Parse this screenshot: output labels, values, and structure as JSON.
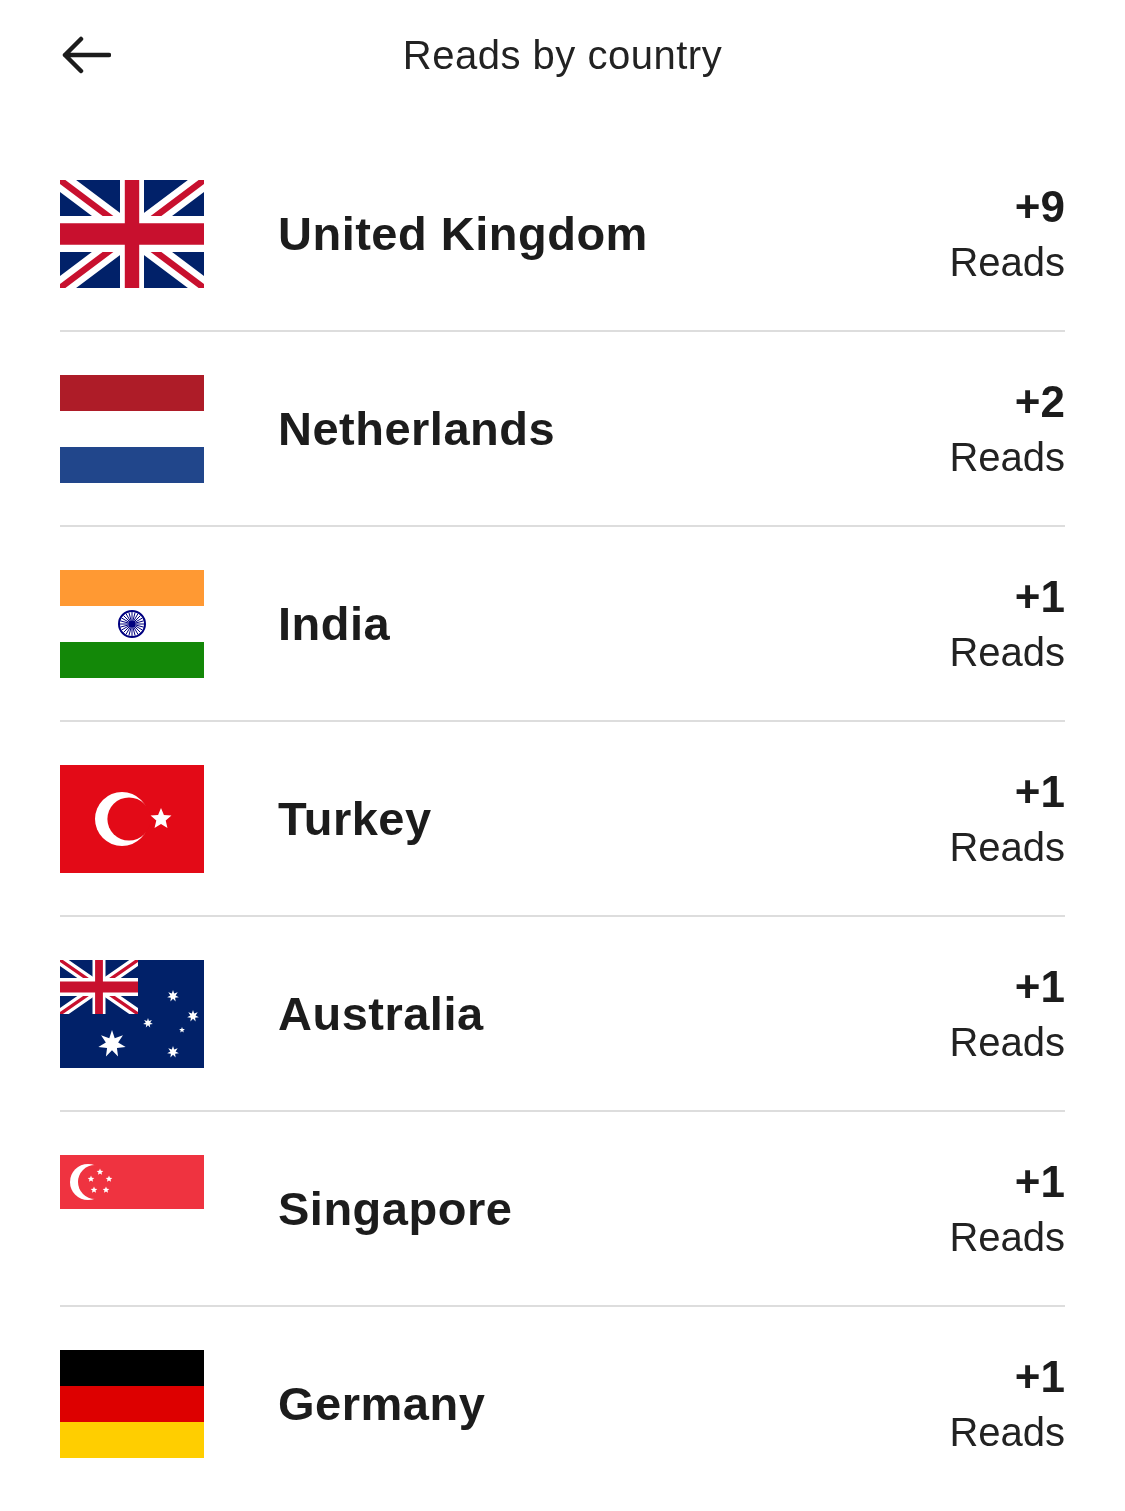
{
  "header": {
    "title": "Reads by country"
  },
  "countries": [
    {
      "kind": "gb",
      "name": "United Kingdom",
      "count": "+9",
      "unit": "Reads"
    },
    {
      "kind": "nl",
      "name": "Netherlands",
      "count": "+2",
      "unit": "Reads"
    },
    {
      "kind": "in",
      "name": "India",
      "count": "+1",
      "unit": "Reads"
    },
    {
      "kind": "tr",
      "name": "Turkey",
      "count": "+1",
      "unit": "Reads"
    },
    {
      "kind": "au",
      "name": "Australia",
      "count": "+1",
      "unit": "Reads"
    },
    {
      "kind": "sg",
      "name": "Singapore",
      "count": "+1",
      "unit": "Reads"
    },
    {
      "kind": "de",
      "name": "Germany",
      "count": "+1",
      "unit": "Reads"
    }
  ]
}
